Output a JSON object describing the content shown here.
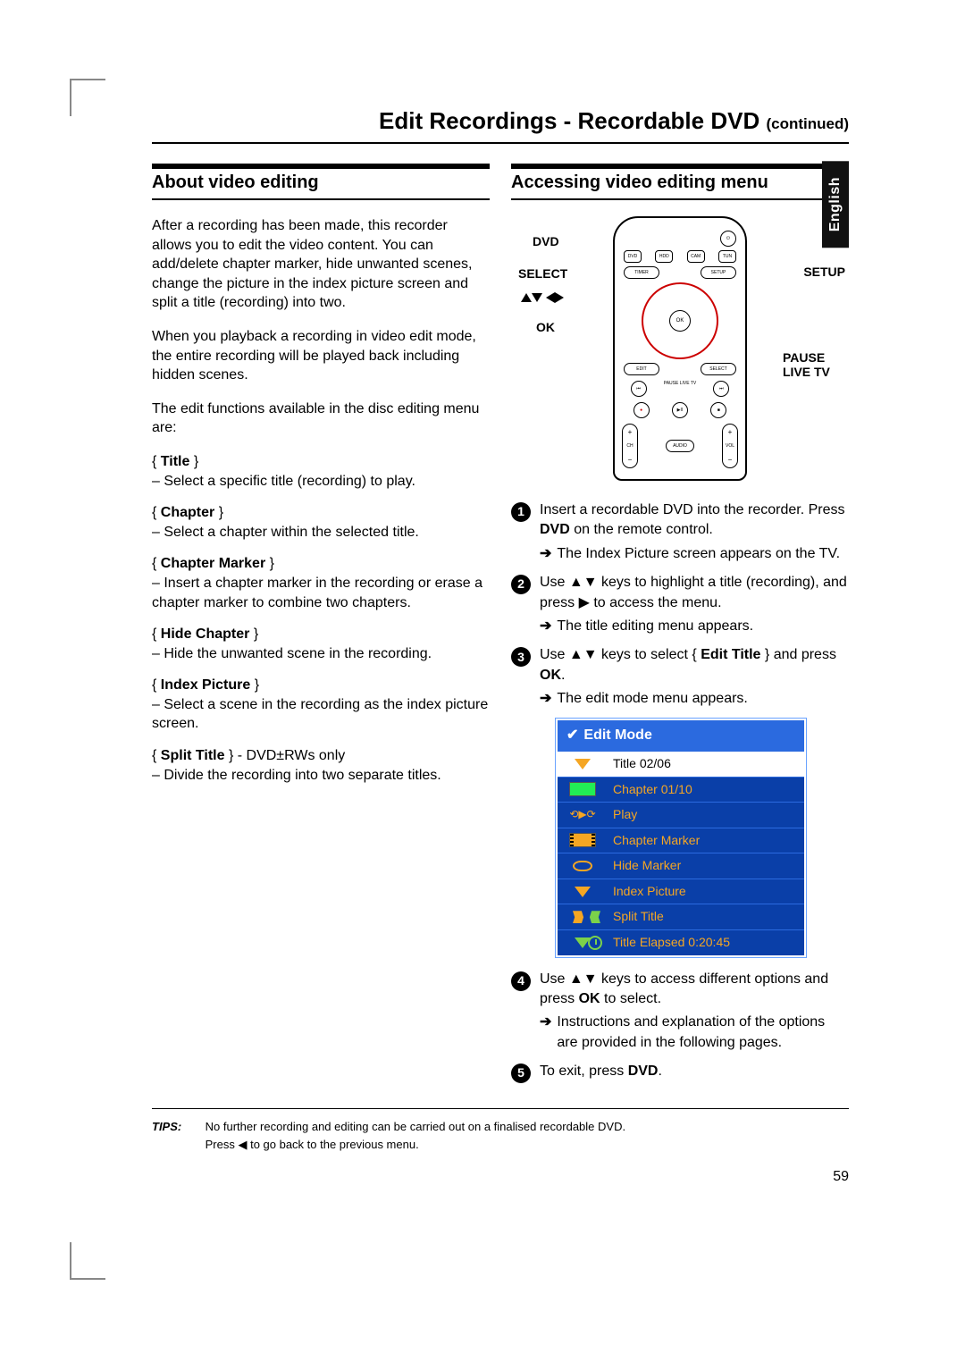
{
  "language_tab": "English",
  "page_title_main": "Edit Recordings - Recordable DVD ",
  "page_title_cont": "(continued)",
  "page_number": "59",
  "left": {
    "heading": "About video editing",
    "p1": "After a recording has been made, this recorder allows you to edit the video content. You can add/delete chapter marker, hide unwanted scenes, change the picture in the index picture screen and split a title (recording) into two.",
    "p2": "When you playback a recording in video edit mode, the entire recording will be played back including hidden scenes.",
    "p3": "The edit functions available in the disc editing menu are:",
    "items": [
      {
        "label": "Title",
        "desc": "–  Select a specific title (recording) to play."
      },
      {
        "label": "Chapter",
        "desc": "–  Select a chapter within the selected title."
      },
      {
        "label": "Chapter Marker",
        "desc": "–  Insert a chapter marker in the recording or erase a chapter marker to combine two chapters."
      },
      {
        "label": "Hide Chapter",
        "desc": "–  Hide the unwanted scene in the recording."
      },
      {
        "label": "Index Picture",
        "desc": "–  Select a scene in the recording as the index picture screen."
      }
    ],
    "split_label": "Split Title",
    "split_suffix": " } - DVD±RWs only",
    "split_desc": "–  Divide the recording into two separate titles."
  },
  "right": {
    "heading": "Accessing video editing menu",
    "remote_labels": {
      "dvd": "DVD",
      "select": "SELECT",
      "ok": "OK",
      "setup": "SETUP",
      "pause": "PAUSE LIVE TV"
    },
    "steps": [
      {
        "n": "1",
        "text_a": "Insert a recordable DVD into the recorder. Press ",
        "bold_a": "DVD",
        "text_b": " on the remote control.",
        "sub": "The Index Picture screen appears on the TV."
      },
      {
        "n": "2",
        "text_a": "Use ▲▼ keys to highlight a title (recording), and press ▶ to access the menu.",
        "sub": "The title editing menu appears."
      },
      {
        "n": "3",
        "text_a": "Use ▲▼ keys to select { ",
        "bold_a": "Edit Title",
        "text_b": " } and press ",
        "bold_b": "OK",
        "text_c": ".",
        "sub": "The edit mode menu appears."
      },
      {
        "n": "4",
        "text_a": "Use ▲▼ keys to access different options and press ",
        "bold_a": "OK",
        "text_b": " to select.",
        "sub": "Instructions and explanation of the options are provided in the following pages."
      },
      {
        "n": "5",
        "text_a": "To exit, press ",
        "bold_a": "DVD",
        "text_b": "."
      }
    ],
    "edit_menu": {
      "header": "Edit Mode",
      "rows": [
        {
          "text": "Title 02/06",
          "sel": true
        },
        {
          "text": "Chapter 01/10"
        },
        {
          "text": "Play"
        },
        {
          "text": "Chapter Marker"
        },
        {
          "text": "Hide Marker"
        },
        {
          "text": "Index Picture"
        },
        {
          "text": "Split Title"
        },
        {
          "text": "Title Elapsed 0:20:45"
        }
      ]
    }
  },
  "tips": {
    "label": "TIPS:",
    "line1": "No further recording and editing can be carried out on a finalised recordable DVD.",
    "line2": "Press ◀ to go back to the previous menu."
  }
}
